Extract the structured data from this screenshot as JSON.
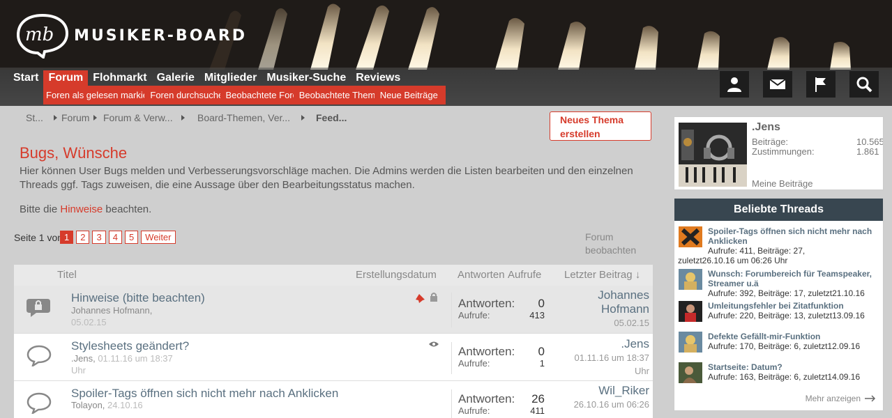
{
  "header": {
    "logo_text": "MUSIKER-BOARD",
    "nav": [
      "Start",
      "Forum",
      "Flohmarkt",
      "Galerie",
      "Mitglieder",
      "Musiker-Suche",
      "Reviews"
    ],
    "subnav": [
      "Foren als gelesen markieren",
      "Foren durchsuchen",
      "Beobachtete Foren",
      "Beobachtete Themen",
      "Neue Beiträge"
    ],
    "icons": [
      "user-icon",
      "mail-icon",
      "flag-icon",
      "search-icon"
    ],
    "accent_color": "#d63b2b"
  },
  "breadcrumb": [
    "St...",
    "Forum",
    "Forum & Verw...",
    "Board-Themen, Ver...",
    "Feed..."
  ],
  "new_thread_label": "Neues Thema erstellen",
  "page": {
    "title": "Bugs, Wünsche",
    "description": "Hier können User Bugs melden und Verbesserungsvorschläge machen. Die Admins werden die Listen bearbeiten und den einzelnen Threads ggf. Tags zuweisen, die eine Aussage über den Bearbeitungsstatus machen.",
    "hint_prefix": "Bitte die",
    "hint_link": "Hinweise",
    "hint_suffix": "beachten."
  },
  "pager": {
    "label": "Seite 1 von 5",
    "pages": [
      "1",
      "2",
      "3",
      "4",
      "5"
    ],
    "next": "Weiter",
    "watch": "Forum beobachten"
  },
  "table": {
    "headers": {
      "title": "Titel",
      "created": "Erstellungsdatum",
      "answers": "Antworten",
      "views": "Aufrufe",
      "last": "Letzter Beitrag ↓"
    },
    "rows": [
      {
        "title": "Hinweise (bitte beachten)",
        "author": "Johannes Hofmann,",
        "date": "05.02.15",
        "answers_label": "Antworten:",
        "answers": "0",
        "views_label": "Aufrufe:",
        "views": "413",
        "last_user": "Johannes Hofmann",
        "last_date": "05.02.15"
      },
      {
        "title": "Stylesheets geändert?",
        "author": ".Jens,",
        "date": "01.11.16 um 18:37 Uhr",
        "answers_label": "Antworten:",
        "answers": "0",
        "views_label": "Aufrufe:",
        "views": "1",
        "last_user": ".Jens",
        "last_date": "01.11.16 um 18:37 Uhr"
      },
      {
        "title": "Spoiler-Tags öffnen sich nicht mehr nach Anklicken",
        "author": "Tolayon,",
        "date": "24.10.16",
        "answers_label": "Antworten:",
        "answers": "26",
        "views_label": "Aufrufe:",
        "views": "411",
        "last_user": "Wil_Riker",
        "last_date": "26.10.16 um 06:26"
      }
    ]
  },
  "user_box": {
    "name": ".Jens",
    "posts_label": "Beiträge:",
    "posts": "10.565",
    "likes_label": "Zustimmungen:",
    "likes": "1.861",
    "my_posts": "Meine Beiträge"
  },
  "popular": {
    "title": "Beliebte Threads",
    "items": [
      {
        "title": "Spoiler-Tags öffnen sich nicht mehr nach Anklicken",
        "info1": "Aufrufe: 411, Beiträge: 27,",
        "info2": "zuletzt26.10.16 um 06:26 Uhr"
      },
      {
        "title": "Wunsch: Forumbereich für Teamspeaker, Streamer u.ä",
        "info1": "Aufrufe: 392, Beiträge: 17, zuletzt21.10.16"
      },
      {
        "title": "Umleitungsfehler bei Zitatfunktion",
        "info1": "Aufrufe: 220, Beiträge: 13, zuletzt13.09.16"
      },
      {
        "title": "Defekte Gefällt-mir-Funktion",
        "info1": "Aufrufe: 170, Beiträge: 6, zuletzt12.09.16"
      },
      {
        "title": "Startseite: Datum?",
        "info1": "Aufrufe: 163, Beiträge: 6, zuletzt14.09.16"
      }
    ],
    "more": "Mehr anzeigen"
  }
}
